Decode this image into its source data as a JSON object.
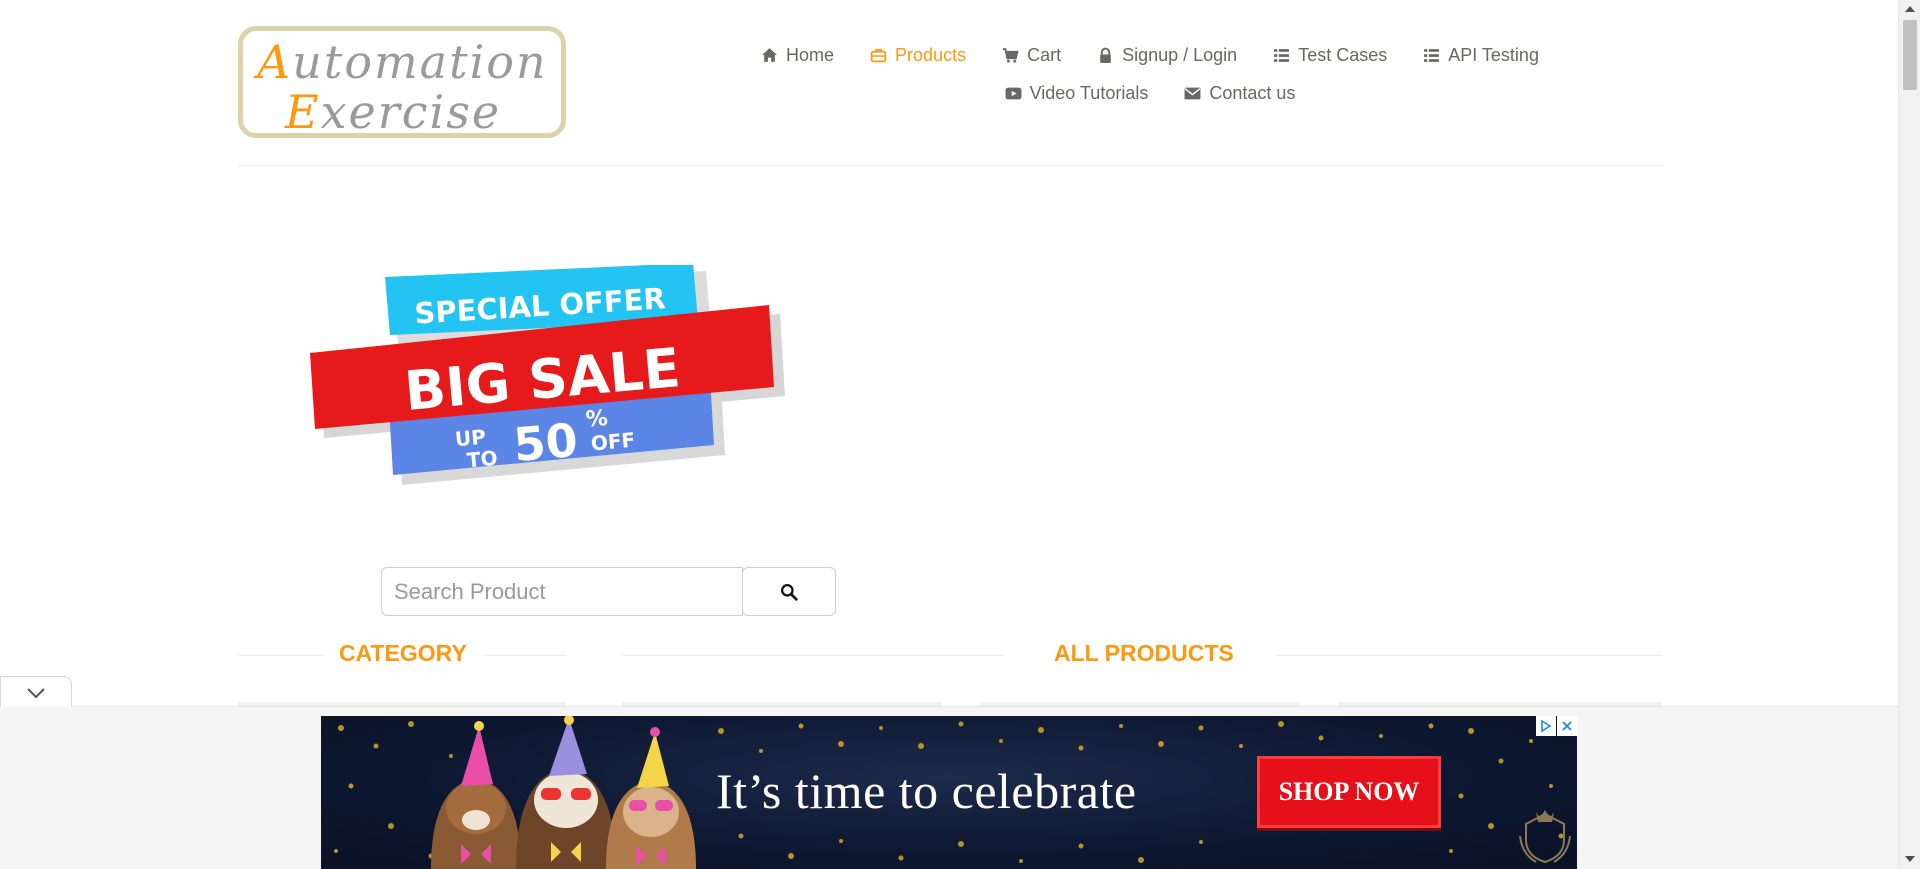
{
  "logo": {
    "line1_cap": "A",
    "line1_rest": "utomation",
    "line2_cap": "E",
    "line2_rest": "xercise"
  },
  "nav": {
    "items": [
      {
        "label": "Home",
        "icon": "home-icon"
      },
      {
        "label": "Products",
        "icon": "briefcase-icon",
        "active": true
      },
      {
        "label": "Cart",
        "icon": "cart-icon"
      },
      {
        "label": "Signup / Login",
        "icon": "lock-icon"
      },
      {
        "label": "Test Cases",
        "icon": "list-icon"
      },
      {
        "label": "API Testing",
        "icon": "list-icon"
      },
      {
        "label": "Video Tutorials",
        "icon": "youtube-icon"
      },
      {
        "label": "Contact us",
        "icon": "envelope-icon"
      }
    ]
  },
  "sale_banner": {
    "line1": "SPECIAL OFFER",
    "line2": "BIG SALE",
    "up": "UP",
    "to": "TO",
    "percent": "50",
    "percent_sign": "%",
    "off": "OFF"
  },
  "search": {
    "placeholder": "Search Product",
    "value": ""
  },
  "sections": {
    "category": "CATEGORY",
    "all_products": "ALL PRODUCTS"
  },
  "ad": {
    "headline": "It’s time to celebrate",
    "cta": "SHOP NOW"
  },
  "colors": {
    "accent": "#fe980f",
    "text": "#696763",
    "ad_bg": "#0d1730",
    "ad_button": "#e5101a"
  }
}
